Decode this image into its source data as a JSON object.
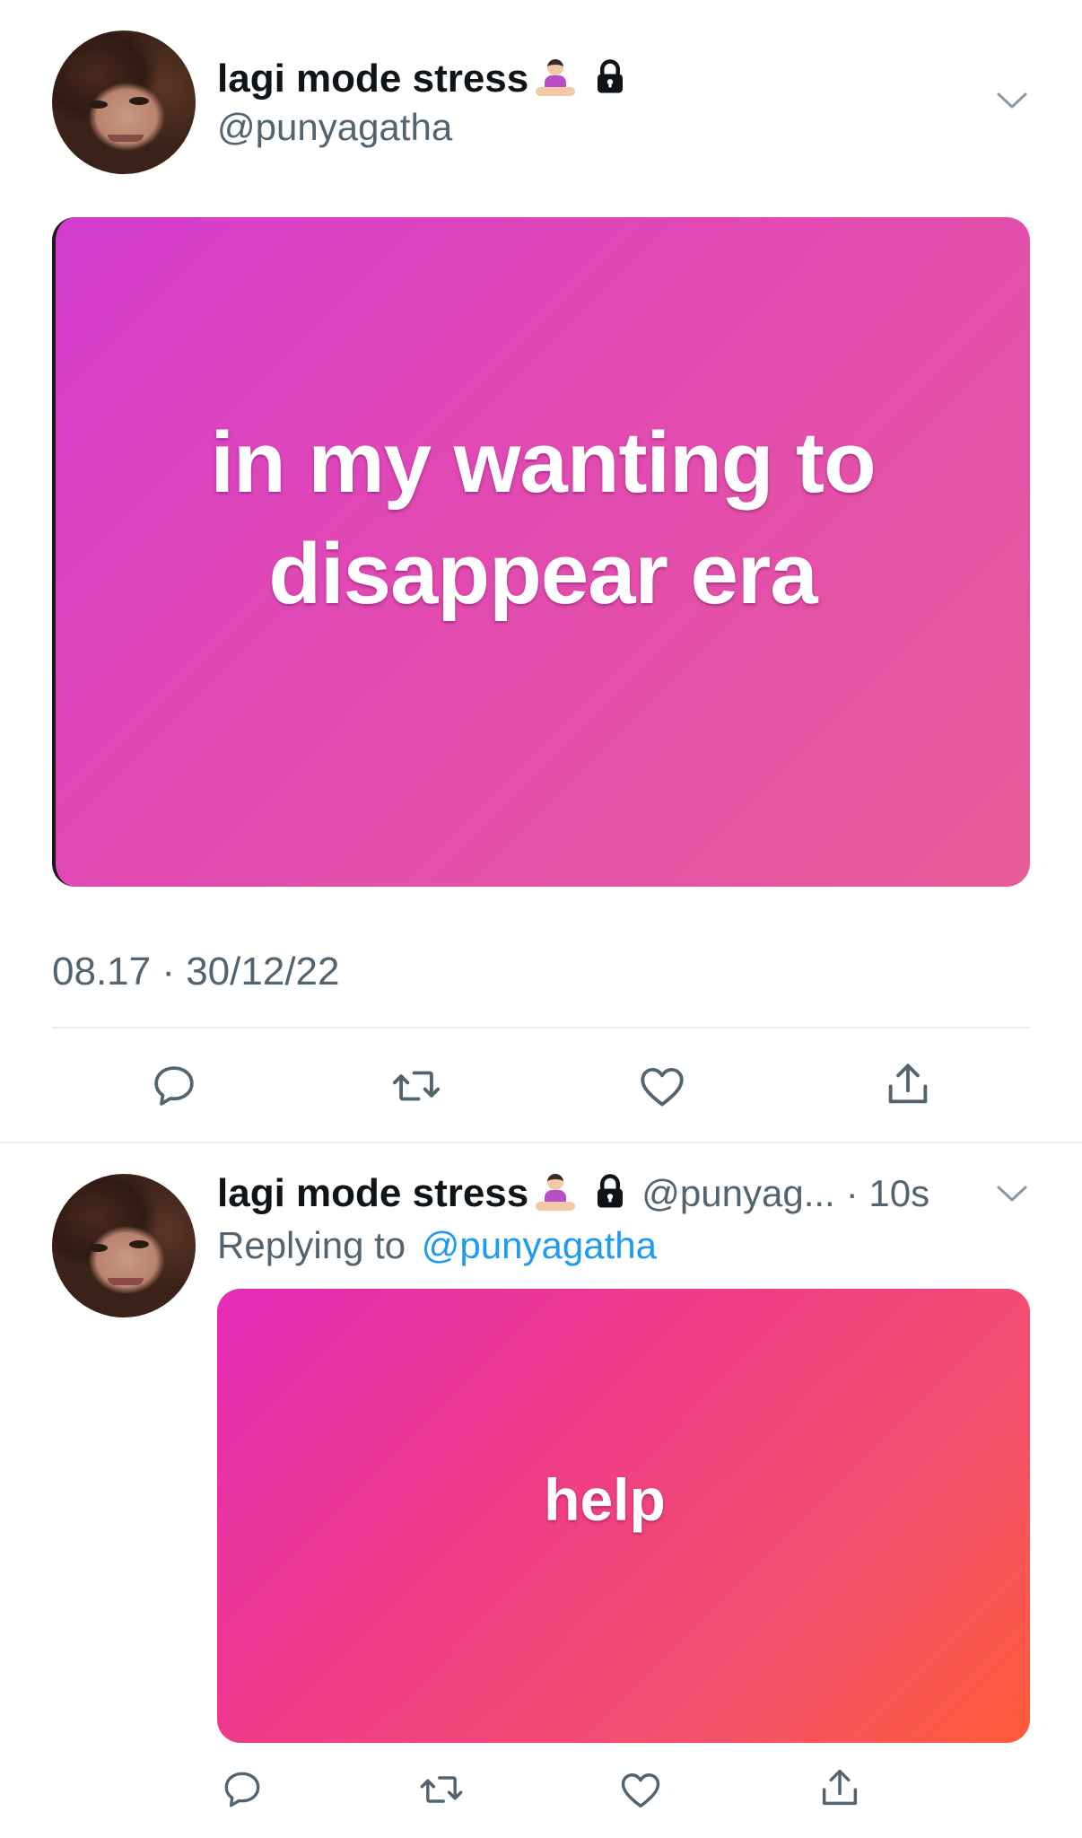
{
  "main_tweet": {
    "display_name": "lagi mode stress",
    "emoji_icon": "person-in-lotus-position-icon",
    "lock_icon": "lock-icon",
    "handle": "@punyagatha",
    "media_text": "in my wanting to disappear era",
    "timestamp": "08.17 · 30/12/22",
    "actions": [
      "reply-icon",
      "retweet-icon",
      "like-icon",
      "share-icon"
    ]
  },
  "reply_tweet": {
    "display_name": "lagi mode stress",
    "handle_truncated": "@punyag...",
    "time_ago": "· 10s",
    "replying_prefix": "Replying to",
    "replying_handle": "@punyagatha",
    "media_text": "help",
    "actions": [
      "reply-icon",
      "retweet-icon",
      "like-icon",
      "share-icon"
    ]
  },
  "colors": {
    "text": "#0f1419",
    "secondary": "#536471",
    "link": "#1d9bf0",
    "icon": "#536471",
    "media1_start": "#d33ccf",
    "media1_end": "#e85c98",
    "media2_start": "#e32bb8",
    "media2_end": "#ff5a36"
  }
}
